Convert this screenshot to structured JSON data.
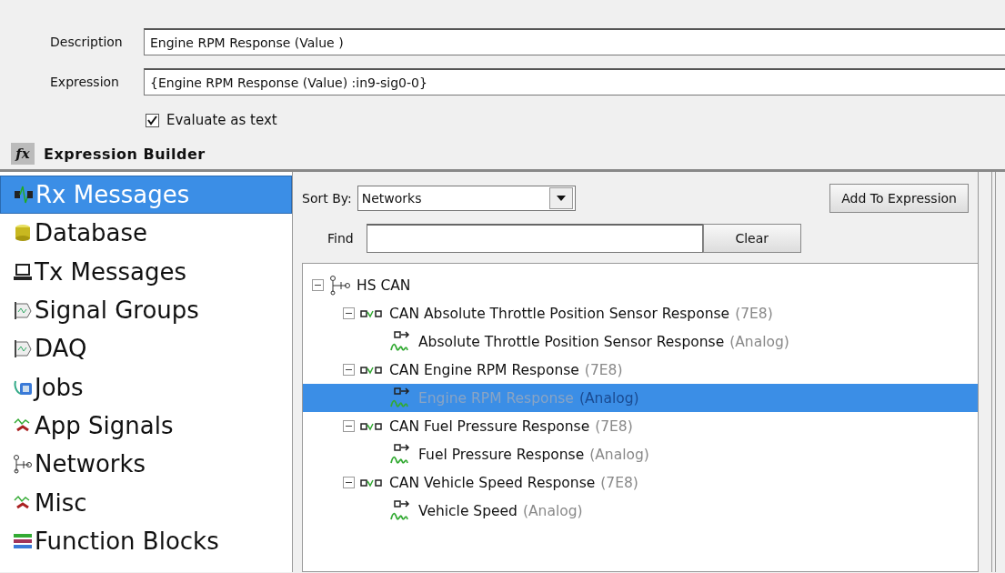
{
  "description": {
    "label": "Description",
    "value": "Engine RPM Response (Value )"
  },
  "expression": {
    "label": "Expression",
    "value": "{Engine RPM Response (Value) :in9-sig0-0}"
  },
  "evaluate_as_text": {
    "label": "Evaluate as text",
    "checked": true
  },
  "builder": {
    "icon_text": "fx",
    "title": "Expression Builder"
  },
  "sidebar": {
    "items": [
      {
        "label": "Rx Messages",
        "selected": true
      },
      {
        "label": "Database",
        "selected": false
      },
      {
        "label": "Tx Messages",
        "selected": false
      },
      {
        "label": "Signal Groups",
        "selected": false
      },
      {
        "label": "DAQ",
        "selected": false
      },
      {
        "label": "Jobs",
        "selected": false
      },
      {
        "label": "App Signals",
        "selected": false
      },
      {
        "label": "Networks",
        "selected": false
      },
      {
        "label": "Misc",
        "selected": false
      },
      {
        "label": "Function Blocks",
        "selected": false
      }
    ]
  },
  "sort_by": {
    "label": "Sort By:",
    "value": "Networks"
  },
  "add_button": "Add To Expression",
  "find": {
    "label": "Find"
  },
  "clear_button": "Clear",
  "tree": [
    {
      "kind": "network",
      "label": "HS CAN",
      "expanded": true,
      "selected": false,
      "children": [
        {
          "kind": "message",
          "label": "CAN Absolute Throttle Position Sensor Response",
          "suffix": "(7E8)",
          "expanded": true,
          "selected": false,
          "children": [
            {
              "kind": "signal",
              "label": "Absolute Throttle Position Sensor Response",
              "suffix": "(Analog)",
              "selected": false
            }
          ]
        },
        {
          "kind": "message",
          "label": "CAN Engine RPM Response",
          "suffix": "(7E8)",
          "expanded": true,
          "selected": false,
          "children": [
            {
              "kind": "signal",
              "label": "Engine RPM Response",
              "suffix": "(Analog)",
              "selected": true
            }
          ]
        },
        {
          "kind": "message",
          "label": "CAN Fuel Pressure Response",
          "suffix": "(7E8)",
          "expanded": true,
          "selected": false,
          "children": [
            {
              "kind": "signal",
              "label": "Fuel Pressure Response",
              "suffix": "(Analog)",
              "selected": false
            }
          ]
        },
        {
          "kind": "message",
          "label": "CAN Vehicle Speed Response",
          "suffix": "(7E8)",
          "expanded": true,
          "selected": false,
          "children": [
            {
              "kind": "signal",
              "label": "Vehicle Speed",
              "suffix": "(Analog)",
              "selected": false
            }
          ]
        }
      ]
    }
  ]
}
